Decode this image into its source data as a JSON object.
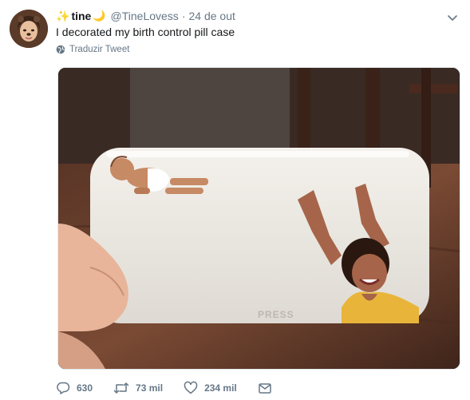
{
  "tweet": {
    "author": {
      "name": "tine",
      "handle": "@TineLovess",
      "avatar_icon": "profile-photo"
    },
    "separator": "·",
    "date": "24 de out",
    "text": "I decorated my birth control pill case",
    "translate_label": "Traduzir Tweet",
    "media": {
      "case_text": "PRESS"
    },
    "actions": {
      "reply_count": "630",
      "retweet_count": "73 mil",
      "like_count": "234 mil"
    },
    "colors": {
      "secondary_text": "#657786",
      "primary_text": "#14171a",
      "border": "#e1e8ed"
    }
  }
}
